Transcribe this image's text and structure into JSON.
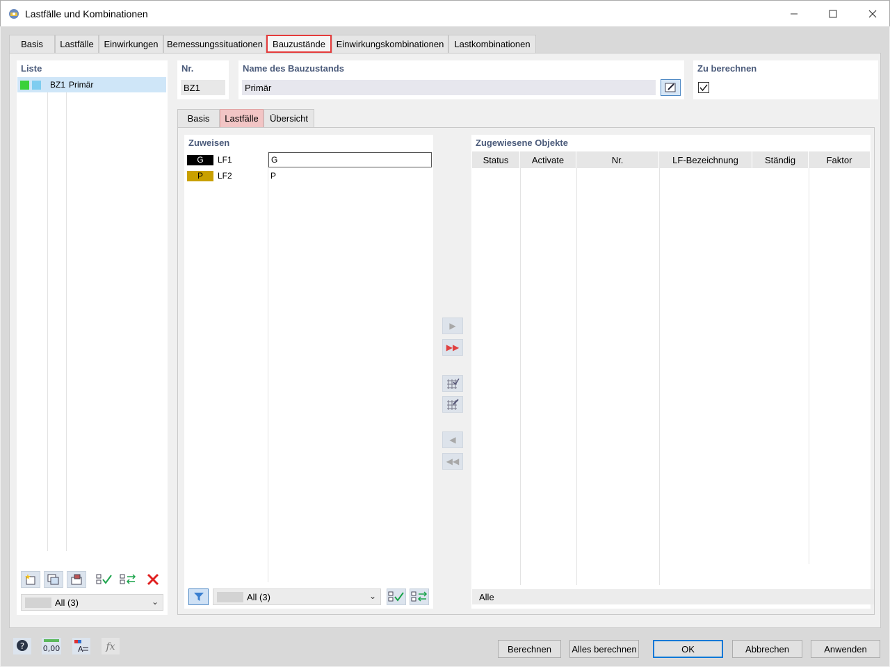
{
  "window": {
    "title": "Lastfälle und Kombinationen"
  },
  "tabs": [
    "Basis",
    "Lastfälle",
    "Einwirkungen",
    "Bemessungssituationen",
    "Bauzustände",
    "Einwirkungskombinationen",
    "Lastkombinationen"
  ],
  "active_tab": "Bauzustände",
  "list": {
    "title": "Liste",
    "items": [
      {
        "id": "BZ1",
        "name": "Primär",
        "colors": [
          "#3ad13a",
          "#7fcdf0"
        ]
      }
    ],
    "filter": "All (3)"
  },
  "nr": {
    "label": "Nr.",
    "value": "BZ1"
  },
  "name": {
    "label": "Name des Bauzustands",
    "value": "Primär"
  },
  "calc": {
    "label": "Zu berechnen",
    "checked": true
  },
  "subtabs": [
    "Basis",
    "Lastfälle",
    "Übersicht"
  ],
  "active_subtab": "Lastfälle",
  "assign": {
    "title": "Zuweisen",
    "items": [
      {
        "badge": "G",
        "badge_bg": "#000000",
        "badge_fg": "#ffffff",
        "id": "LF1",
        "desc": "G"
      },
      {
        "badge": "P",
        "badge_bg": "#c9a000",
        "badge_fg": "#000000",
        "id": "LF2",
        "desc": "P"
      }
    ],
    "filter": "All (3)"
  },
  "assigned": {
    "title": "Zugewiesene Objekte",
    "columns": [
      "Status",
      "Activate",
      "Nr.",
      "LF-Bezeichnung",
      "Ständig",
      "Faktor"
    ],
    "footer": "Alle"
  },
  "buttons": {
    "calc": "Berechnen",
    "calc_all": "Alles berechnen",
    "ok": "OK",
    "cancel": "Abbrechen",
    "apply": "Anwenden"
  },
  "colors": {
    "accent": "#0078d7",
    "highlight_tab": "#e53b3b",
    "title_blue": "#4a5a7a"
  }
}
